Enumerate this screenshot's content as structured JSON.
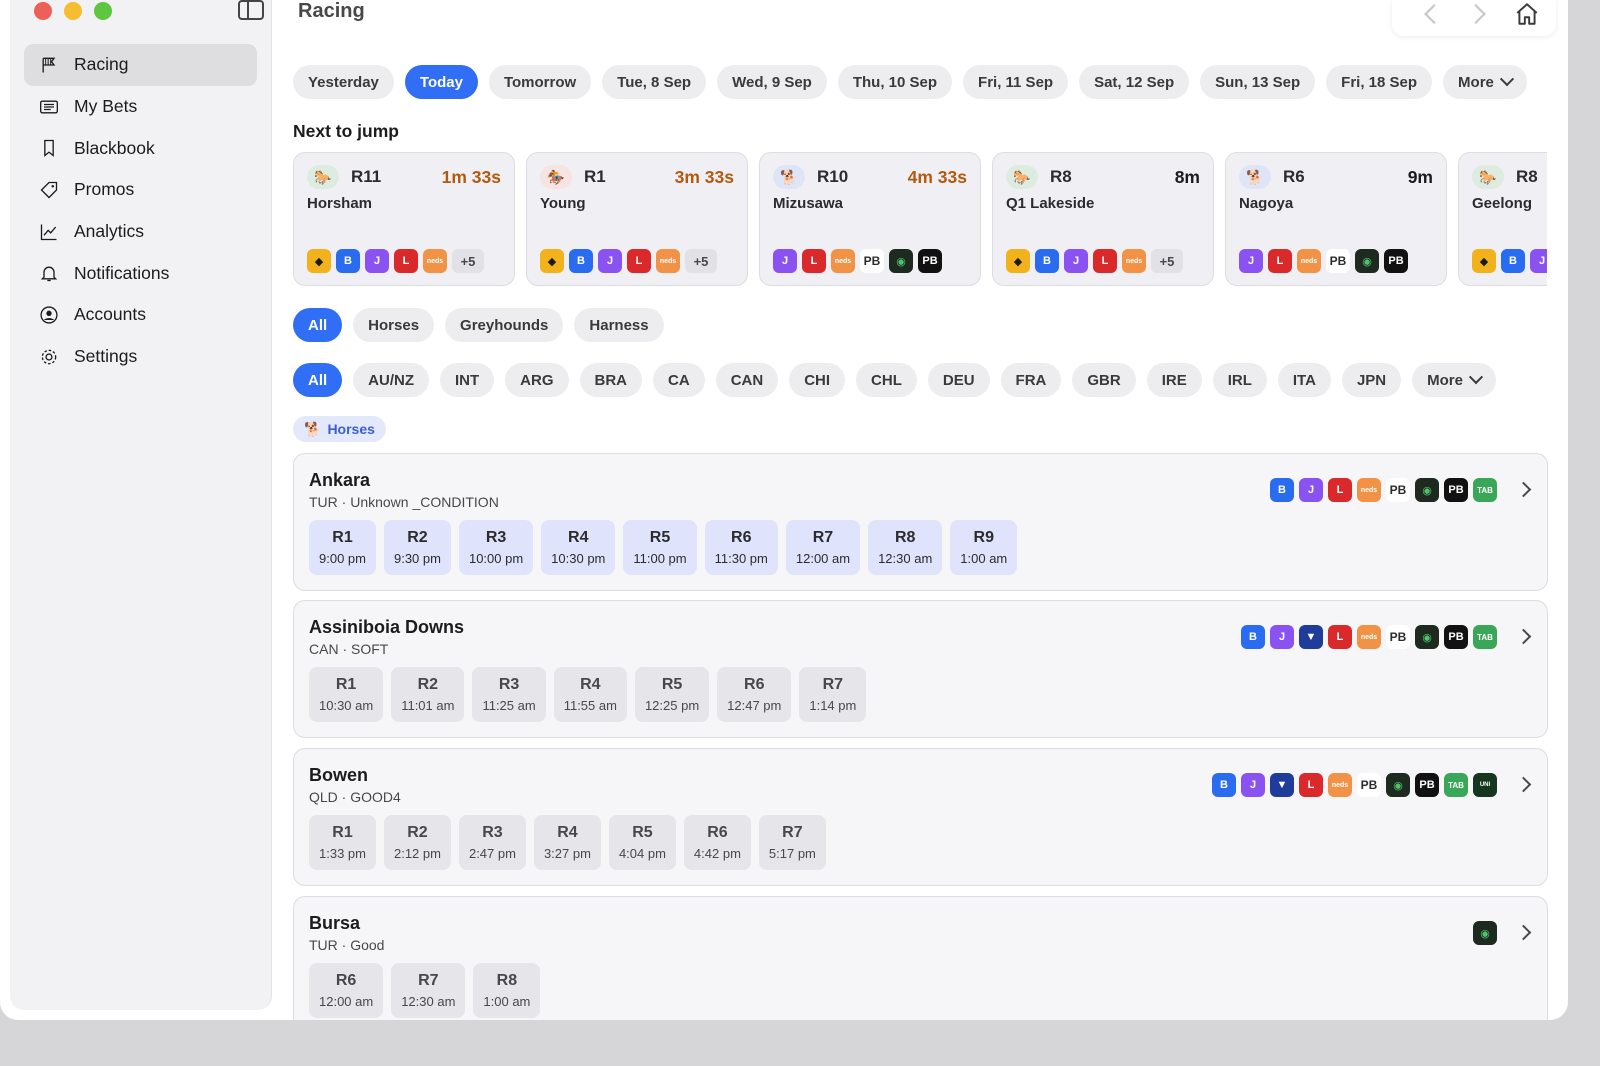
{
  "app": {
    "title": "Racing"
  },
  "sidebar": {
    "items": [
      {
        "label": "Racing",
        "icon": "flag-icon",
        "active": true
      },
      {
        "label": "My Bets",
        "icon": "ticket-icon"
      },
      {
        "label": "Blackbook",
        "icon": "bookmark-icon"
      },
      {
        "label": "Promos",
        "icon": "tag-icon"
      },
      {
        "label": "Analytics",
        "icon": "chart-icon"
      },
      {
        "label": "Notifications",
        "icon": "bell-icon"
      },
      {
        "label": "Accounts",
        "icon": "user-circle-icon"
      },
      {
        "label": "Settings",
        "icon": "gear-icon"
      }
    ]
  },
  "days": [
    "Yesterday",
    "Today",
    "Tomorrow",
    "Tue, 8 Sep",
    "Wed, 9 Sep",
    "Thu, 10 Sep",
    "Fri, 11 Sep",
    "Sat, 12 Sep",
    "Sun, 13 Sep",
    "Fri, 18 Sep"
  ],
  "days_more": "More",
  "next_to_jump": {
    "title": "Next to jump",
    "cards": [
      {
        "type": "horse",
        "race": "R11",
        "time": "1m 33s",
        "venue": "Horsham",
        "books": [
          "bet365",
          "blue",
          "purple",
          "red",
          "orange"
        ],
        "more": "+5"
      },
      {
        "type": "harness",
        "race": "R1",
        "time": "3m 33s",
        "venue": "Young",
        "books": [
          "bet365",
          "blue",
          "purple",
          "red",
          "orange"
        ],
        "more": "+5"
      },
      {
        "type": "hound",
        "race": "R10",
        "time": "4m 33s",
        "venue": "Mizusawa",
        "books": [
          "purple",
          "red",
          "orange",
          "pb",
          "green",
          "black"
        ],
        "more": ""
      },
      {
        "type": "horse",
        "race": "R8",
        "time": "8m",
        "venue": "Q1 Lakeside",
        "books": [
          "bet365",
          "blue",
          "purple",
          "red",
          "orange"
        ],
        "more": "+5"
      },
      {
        "type": "hound",
        "race": "R6",
        "time": "9m",
        "venue": "Nagoya",
        "books": [
          "purple",
          "red",
          "orange",
          "pb",
          "green",
          "black"
        ],
        "more": ""
      },
      {
        "type": "horse",
        "race": "R8",
        "time": "",
        "venue": "Geelong",
        "books": [
          "bet365",
          "blue",
          "purple"
        ],
        "more": ""
      }
    ]
  },
  "race_types": [
    "All",
    "Horses",
    "Greyhounds",
    "Harness"
  ],
  "regions": [
    "All",
    "AU/NZ",
    "INT",
    "ARG",
    "BRA",
    "CA",
    "CAN",
    "CHI",
    "CHL",
    "DEU",
    "FRA",
    "GBR",
    "IRE",
    "IRL",
    "ITA",
    "JPN"
  ],
  "regions_more": "More",
  "filter_tag": "Horses",
  "meetings": [
    {
      "name": "Ankara",
      "sub": "TUR · Unknown _CONDITION",
      "active": true,
      "books": [
        "blue",
        "purple",
        "red",
        "orange",
        "pb",
        "green",
        "black",
        "tab"
      ],
      "races": [
        {
          "no": "R1",
          "time": "9:00 pm"
        },
        {
          "no": "R2",
          "time": "9:30 pm"
        },
        {
          "no": "R3",
          "time": "10:00 pm"
        },
        {
          "no": "R4",
          "time": "10:30 pm"
        },
        {
          "no": "R5",
          "time": "11:00 pm"
        },
        {
          "no": "R6",
          "time": "11:30 pm"
        },
        {
          "no": "R7",
          "time": "12:00 am"
        },
        {
          "no": "R8",
          "time": "12:30 am"
        },
        {
          "no": "R9",
          "time": "1:00 am"
        }
      ]
    },
    {
      "name": "Assiniboia Downs",
      "sub": "CAN · SOFT",
      "active": false,
      "books": [
        "blue",
        "purple",
        "navy",
        "red",
        "orange",
        "pb",
        "green",
        "black",
        "tab"
      ],
      "races": [
        {
          "no": "R1",
          "time": "10:30 am"
        },
        {
          "no": "R2",
          "time": "11:01 am"
        },
        {
          "no": "R3",
          "time": "11:25 am"
        },
        {
          "no": "R4",
          "time": "11:55 am"
        },
        {
          "no": "R5",
          "time": "12:25 pm"
        },
        {
          "no": "R6",
          "time": "12:47 pm"
        },
        {
          "no": "R7",
          "time": "1:14 pm"
        }
      ]
    },
    {
      "name": "Bowen",
      "sub": "QLD · GOOD4",
      "active": false,
      "books": [
        "blue",
        "purple",
        "navy",
        "red",
        "orange",
        "pb",
        "green",
        "black",
        "tab",
        "unibet"
      ],
      "races": [
        {
          "no": "R1",
          "time": "1:33 pm"
        },
        {
          "no": "R2",
          "time": "2:12 pm"
        },
        {
          "no": "R3",
          "time": "2:47 pm"
        },
        {
          "no": "R4",
          "time": "3:27 pm"
        },
        {
          "no": "R5",
          "time": "4:04 pm"
        },
        {
          "no": "R6",
          "time": "4:42 pm"
        },
        {
          "no": "R7",
          "time": "5:17 pm"
        }
      ]
    },
    {
      "name": "Bursa",
      "sub": "TUR · Good",
      "active": false,
      "books": [
        "green"
      ],
      "races": [
        {
          "no": "R6",
          "time": "12:00 am"
        },
        {
          "no": "R7",
          "time": "12:30 am"
        },
        {
          "no": "R8",
          "time": "1:00 am"
        }
      ]
    }
  ]
}
